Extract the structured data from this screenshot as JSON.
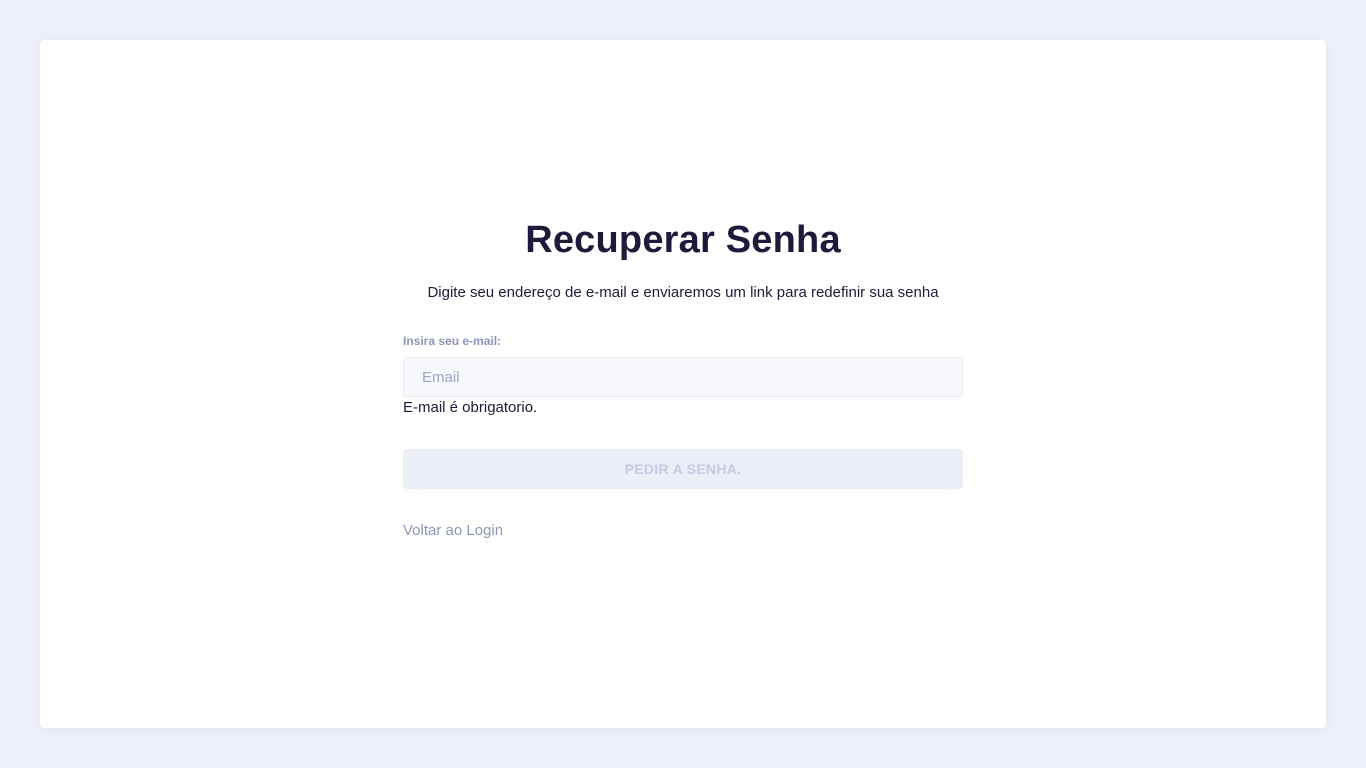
{
  "page": {
    "title": "Recuperar Senha",
    "subtitle": "Digite seu endereço de e-mail e enviaremos um link para redefinir sua senha"
  },
  "form": {
    "email_label": "Insira seu e-mail:",
    "email_placeholder": "Email",
    "email_value": "",
    "error_message": "E-mail é obrigatorio.",
    "submit_label": "PEDIR A SENHA.",
    "back_link_label": "Voltar ao Login"
  },
  "colors": {
    "background": "#eef0f8",
    "card": "#ffffff",
    "text_dark": "#1e1b3a",
    "muted": "#8e93b8",
    "button_disabled_bg": "#eceef8",
    "button_disabled_text": "#c6c9e2"
  }
}
